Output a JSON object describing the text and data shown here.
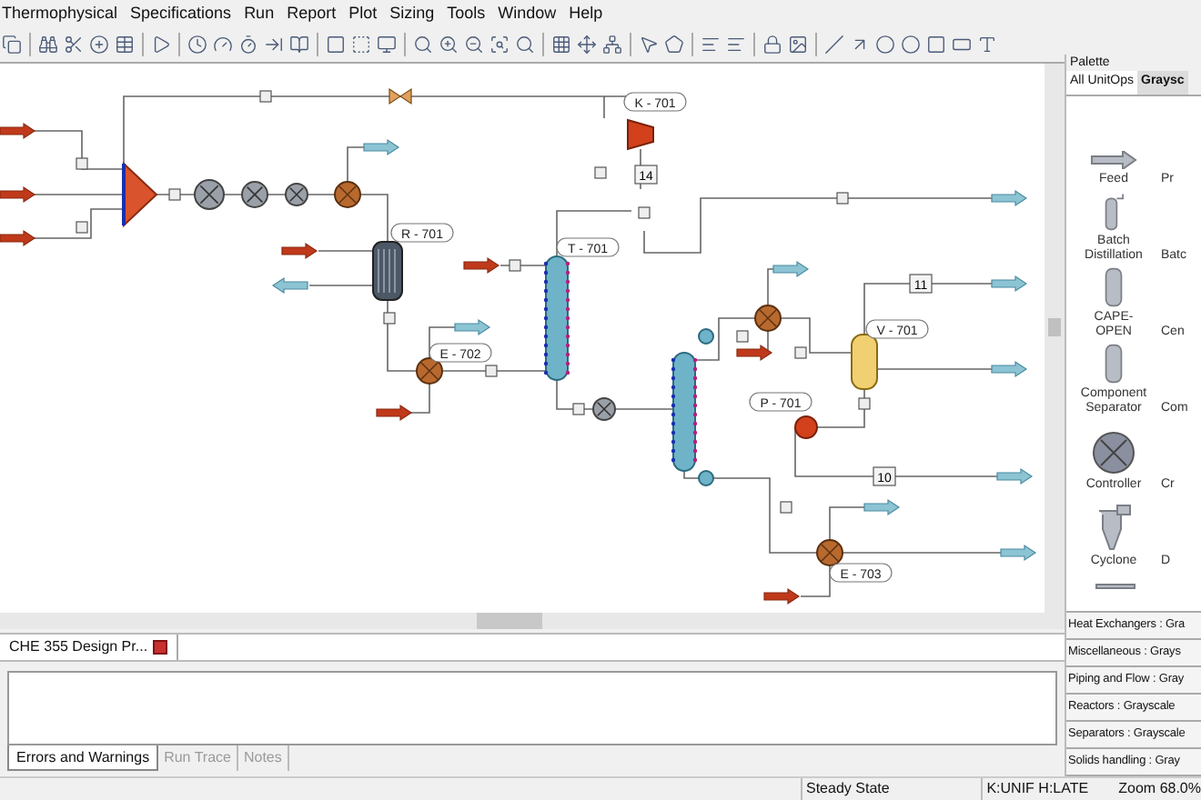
{
  "menu": [
    "Thermophysical",
    "Specifications",
    "Run",
    "Report",
    "Plot",
    "Sizing",
    "Tools",
    "Window",
    "Help"
  ],
  "flowsheet": {
    "units": [
      {
        "kind": "compressor",
        "label": "K - 701"
      },
      {
        "kind": "reactor",
        "label": "R - 701"
      },
      {
        "kind": "heater",
        "label": "E - 702"
      },
      {
        "kind": "column",
        "label": "T - 701"
      },
      {
        "kind": "drum",
        "label": "V - 701"
      },
      {
        "kind": "pump",
        "label": "P - 701"
      },
      {
        "kind": "heater",
        "label": "E - 703"
      }
    ],
    "stream_tags": [
      "14",
      "11",
      "10"
    ]
  },
  "document_tab": {
    "label": "CHE 355 Design Pr..."
  },
  "message_tabs": [
    {
      "label": "Errors and Warnings",
      "selected": true
    },
    {
      "label": "Run Trace",
      "selected": false
    },
    {
      "label": "Notes",
      "selected": false
    }
  ],
  "palette": {
    "title": "Palette",
    "tabs": [
      {
        "label": "All UnitOps",
        "selected": false
      },
      {
        "label": "Graysc",
        "selected": true
      }
    ],
    "items": [
      {
        "label": "Feed",
        "cut_label": "Pr"
      },
      {
        "label": "Batch Distillation",
        "cut_label": "Batc"
      },
      {
        "label": "CAPE-OPEN",
        "cut_label": "Cen"
      },
      {
        "label": "Component Separator",
        "cut_label": "Com"
      },
      {
        "label": "Controller",
        "cut_label": "Cr"
      },
      {
        "label": "Cyclone",
        "cut_label": "D"
      }
    ],
    "categories": [
      "Heat Exchangers : Gra",
      "Miscellaneous : Grays",
      "Piping and Flow : Gray",
      "Reactors : Grayscale",
      "Separators : Grayscale",
      "Solids handling : Gray"
    ]
  },
  "status_bar": {
    "mode": "Steady State",
    "models": "K:UNIF H:LATE",
    "zoom": "Zoom 68.0%"
  }
}
